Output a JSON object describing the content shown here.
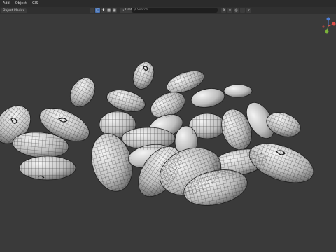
{
  "menubar": {
    "items": [
      "Add",
      "Object",
      "GIS"
    ]
  },
  "header": {
    "mode_label": "Object Mode",
    "transform_orientation": "Global",
    "search_placeholder": "Search"
  },
  "colors": {
    "background": "#3a3a3a",
    "accent": "#4772b3",
    "gizmo_x": "#e0514b",
    "gizmo_y": "#7bb33b",
    "gizmo_z": "#4f7fd6"
  },
  "icons": [
    "cursor-icon",
    "select-box-icon",
    "move-icon",
    "global-axis-icon",
    "snap-icon",
    "proportional-edit-icon",
    "filter-icon",
    "gizmo-axes-icon"
  ]
}
